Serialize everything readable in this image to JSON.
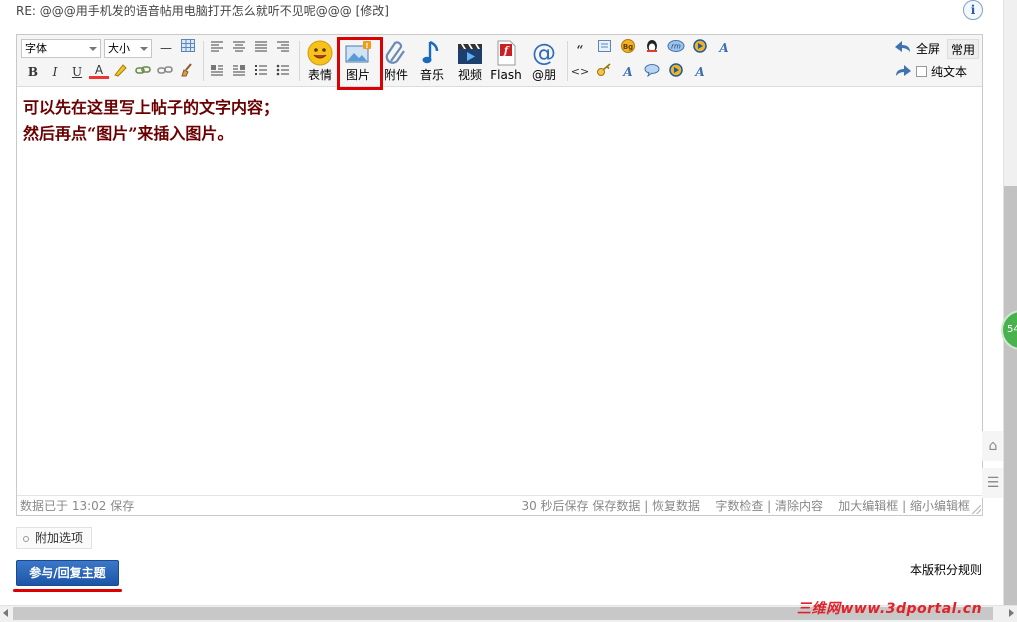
{
  "title_line": {
    "text": "RE: @@@用手机发的语音帖用电脑打开怎么就听不见呢@@@",
    "edit": "[修改]"
  },
  "info_icon": "info-icon",
  "toolbar": {
    "font_select": "字体",
    "size_select": "大小",
    "format_buttons": [
      "B",
      "I",
      "U",
      "A"
    ],
    "big_buttons": [
      {
        "label": "表情",
        "icon": "smiley-icon"
      },
      {
        "label": "图片",
        "icon": "image-icon"
      },
      {
        "label": "附件",
        "icon": "paperclip-icon"
      },
      {
        "label": "音乐",
        "icon": "music-note-icon"
      },
      {
        "label": "视频",
        "icon": "video-clapper-icon"
      },
      {
        "label": "Flash",
        "icon": "flash-icon"
      },
      {
        "label": "@朋",
        "icon": "at-sign-icon"
      }
    ],
    "quote_glyph": "“",
    "code_glyph": "<>",
    "fullscreen": "全屏",
    "common": "常用",
    "plaintext": "纯文本"
  },
  "content": {
    "line1": "可以先在这里写上帖子的文字内容；",
    "line2": "然后再点“图片”来插入图片。"
  },
  "status": {
    "saved": "数据已于 13:02 保存",
    "autosave": "30 秒后保存",
    "save_data": "保存数据",
    "restore": "恢复数据",
    "check": "字数检查",
    "clear": "清除内容",
    "enlarge": "加大编辑框",
    "shrink": "缩小编辑框"
  },
  "extra_options": "附加选项",
  "submit": "参与/回复主题",
  "rules": "本版积分规则",
  "float_badge": "54",
  "watermark": "三维网www.3dportal.cn",
  "colors": {
    "accent_red": "#dd0000",
    "content_text": "#6b0000",
    "submit_blue": "#1d55a6"
  }
}
